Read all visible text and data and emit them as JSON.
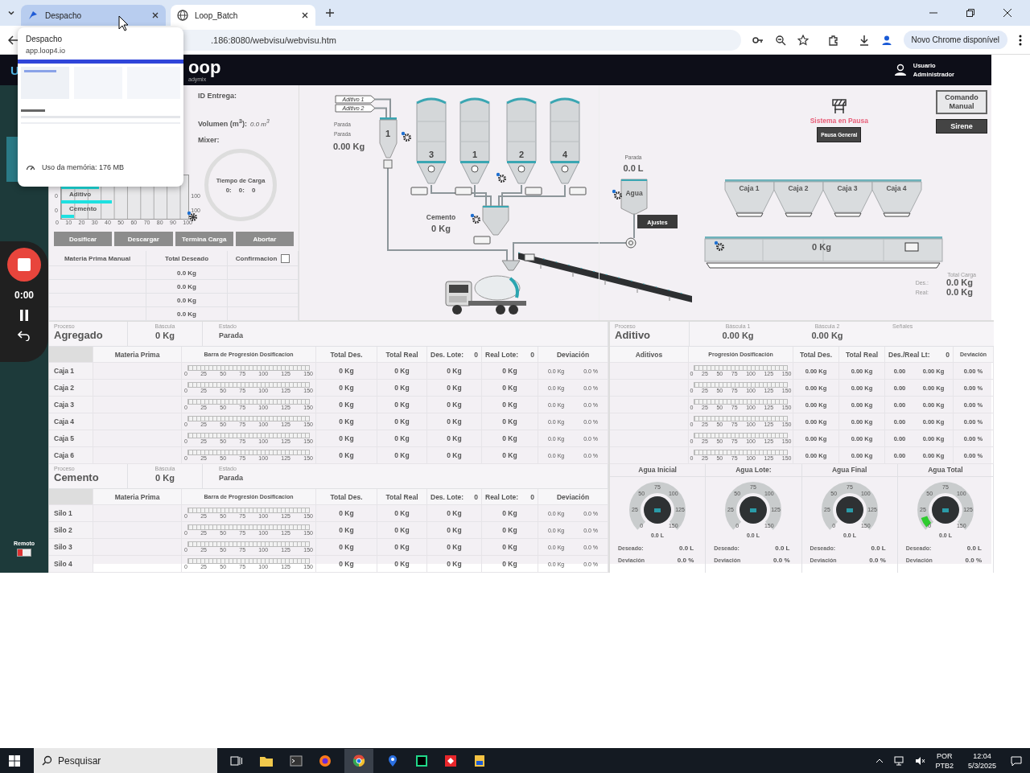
{
  "browser": {
    "tabs": [
      {
        "title": "Despacho",
        "selected": false,
        "hovered": true
      },
      {
        "title": "Loop_Batch",
        "selected": true,
        "hovered": false
      }
    ],
    "url": ".186:8080/webvisu/webvisu.htm",
    "update_button": "Novo Chrome disponível",
    "tab_preview": {
      "title": "Despacho",
      "domain": "app.loop4.io",
      "memory": "Uso da memória: 176 MB"
    }
  },
  "header": {
    "logo_left": "U",
    "logo": "oop",
    "logo_sub": "adymix",
    "user_role": "Usuario",
    "user_name": "Administrador"
  },
  "sidebar": {
    "remote_label": "Remoto",
    "remote_on": false
  },
  "recorder": {
    "time": "0:00"
  },
  "load": {
    "id_label": "ID Entrega:",
    "volume_label": "Volumen (m$^{3}$):",
    "volume": "0.0 m$^{3}$",
    "mixer_label": "Mixer:",
    "bars": [
      {
        "level": 0.3
      },
      {
        "label": "Aditivo",
        "level": 0.4,
        "min": "0",
        "max": "100"
      },
      {
        "label": "Cemento",
        "level": 0.1,
        "min": "0",
        "max": "100"
      }
    ],
    "x_ticks": [
      "0",
      "10",
      "20",
      "30",
      "40",
      "50",
      "60",
      "70",
      "80",
      "90",
      "100"
    ],
    "timer": {
      "title": "Tiempo de Carga",
      "parts": [
        "0:",
        "0:",
        "0"
      ]
    }
  },
  "buttons": [
    {
      "label": "Dosificar",
      "disabled": true
    },
    {
      "label": "Descargar",
      "disabled": true
    },
    {
      "label": "Termina Carga",
      "disabled": true
    },
    {
      "label": "Abortar",
      "disabled": true
    }
  ],
  "manual_table": {
    "columns": [
      "Materia Prima Manual",
      "Total Deseado",
      "Confirmacion"
    ],
    "confirm_checked": false,
    "rows": [
      "0.0 Kg",
      "0.0 Kg",
      "0.0 Kg",
      "0.0 Kg"
    ]
  },
  "diagram": {
    "inlets": [
      "Aditivo 1",
      "Aditivo 2"
    ],
    "additive_hopper": {
      "label": "1",
      "status_1": "Parada",
      "status_2": "Parada",
      "weight": "0.00 Kg"
    },
    "silos": [
      {
        "label": "3"
      },
      {
        "label": "1"
      },
      {
        "label": "2"
      },
      {
        "label": "4"
      }
    ],
    "cement_hopper": {
      "label": "Cemento",
      "weight": "0 Kg"
    },
    "water_tank": {
      "status": "Parada",
      "volume": "0.0 L",
      "label": "Agua"
    },
    "settings_button": "Ajustes"
  },
  "pause": {
    "status": "Sistema en Pausa",
    "button": "Pausa General"
  },
  "manual_button": "Comando Manual",
  "siren_button": "Sirene",
  "bins": [
    "Caja 1",
    "Caja 2",
    "Caja 3",
    "Caja 4"
  ],
  "belt_scale": "0 Kg",
  "total_load": {
    "title": "Total Carga",
    "desired_label": "Des.:",
    "desired": "0.0 Kg",
    "real_label": "Real:",
    "real": "0.0 Kg"
  },
  "aggregate": {
    "process_label": "Proceso",
    "process": "Agregado",
    "scale_label": "Báscula",
    "scale": "0 Kg",
    "state_label": "Estado",
    "state": "Parada",
    "columns": [
      "Materia Prima",
      "Barra de Progresión Dosificacion",
      "Total Des.",
      "Total Real",
      "Des. Lote:",
      "Real Lote:",
      "Deviación"
    ],
    "des_lote": "0",
    "real_lote": "0",
    "rows": [
      {
        "name": "Caja 1",
        "ticks": [
          "0",
          "25",
          "50",
          "75",
          "100",
          "125",
          "150"
        ],
        "total_des": "0 Kg",
        "total_real": "0 Kg",
        "des_lote": "0 Kg",
        "real_lote": "0 Kg",
        "dev_kg": "0.0 Kg",
        "dev_pct": "0.0 %"
      },
      {
        "name": "Caja 2",
        "ticks": [
          "0",
          "25",
          "50",
          "75",
          "100",
          "125",
          "150"
        ],
        "total_des": "0 Kg",
        "total_real": "0 Kg",
        "des_lote": "0 Kg",
        "real_lote": "0 Kg",
        "dev_kg": "0.0 Kg",
        "dev_pct": "0.0 %"
      },
      {
        "name": "Caja 3",
        "ticks": [
          "0",
          "25",
          "50",
          "75",
          "100",
          "125",
          "150"
        ],
        "total_des": "0 Kg",
        "total_real": "0 Kg",
        "des_lote": "0 Kg",
        "real_lote": "0 Kg",
        "dev_kg": "0.0 Kg",
        "dev_pct": "0.0 %"
      },
      {
        "name": "Caja 4",
        "ticks": [
          "0",
          "25",
          "50",
          "75",
          "100",
          "125",
          "150"
        ],
        "total_des": "0 Kg",
        "total_real": "0 Kg",
        "des_lote": "0 Kg",
        "real_lote": "0 Kg",
        "dev_kg": "0.0 Kg",
        "dev_pct": "0.0 %"
      },
      {
        "name": "Caja 5",
        "ticks": [
          "0",
          "25",
          "50",
          "75",
          "100",
          "125",
          "150"
        ],
        "total_des": "0 Kg",
        "total_real": "0 Kg",
        "des_lote": "0 Kg",
        "real_lote": "0 Kg",
        "dev_kg": "0.0 Kg",
        "dev_pct": "0.0 %"
      },
      {
        "name": "Caja 6",
        "ticks": [
          "0",
          "25",
          "50",
          "75",
          "100",
          "125",
          "150"
        ],
        "total_des": "0 Kg",
        "total_real": "0 Kg",
        "des_lote": "0 Kg",
        "real_lote": "0 Kg",
        "dev_kg": "0.0 Kg",
        "dev_pct": "0.0 %"
      }
    ]
  },
  "cement": {
    "process_label": "Proceso",
    "process": "Cemento",
    "scale_label": "Báscula",
    "scale": "0 Kg",
    "state_label": "Estado",
    "state": "Parada",
    "columns": [
      "Materia Prima",
      "Barra de Progresión Dosificacion",
      "Total Des.",
      "Total Real",
      "Des. Lote:",
      "Real Lote:",
      "Deviación"
    ],
    "des_lote": "0",
    "real_lote": "0",
    "rows": [
      {
        "name": "Silo 1",
        "ticks": [
          "0",
          "25",
          "50",
          "75",
          "100",
          "125",
          "150"
        ],
        "total_des": "0 Kg",
        "total_real": "0 Kg",
        "des_lote": "0 Kg",
        "real_lote": "0 Kg",
        "dev_kg": "0.0 Kg",
        "dev_pct": "0.0 %"
      },
      {
        "name": "Silo 2",
        "ticks": [
          "0",
          "25",
          "50",
          "75",
          "100",
          "125",
          "150"
        ],
        "total_des": "0 Kg",
        "total_real": "0 Kg",
        "des_lote": "0 Kg",
        "real_lote": "0 Kg",
        "dev_kg": "0.0 Kg",
        "dev_pct": "0.0 %"
      },
      {
        "name": "Silo 3",
        "ticks": [
          "0",
          "25",
          "50",
          "75",
          "100",
          "125",
          "150"
        ],
        "total_des": "0 Kg",
        "total_real": "0 Kg",
        "des_lote": "0 Kg",
        "real_lote": "0 Kg",
        "dev_kg": "0.0 Kg",
        "dev_pct": "0.0 %"
      },
      {
        "name": "Silo 4",
        "ticks": [
          "0",
          "25",
          "50",
          "75",
          "100",
          "125",
          "150"
        ],
        "total_des": "0 Kg",
        "total_real": "0 Kg",
        "des_lote": "0 Kg",
        "real_lote": "0 Kg",
        "dev_kg": "0.0 Kg",
        "dev_pct": "0.0 %"
      }
    ]
  },
  "additive": {
    "process_label": "Proceso",
    "process": "Aditivo",
    "scale1_label": "Báscula 1",
    "scale1": "0.00 Kg",
    "scale2_label": "Báscula 2",
    "scale2": "0.00 Kg",
    "signals_label": "Señales",
    "columns": [
      "Aditivos",
      "Progresión Dosificación",
      "Total Des.",
      "Total Real",
      "Des./Real Lt:",
      "Deviación"
    ],
    "lot": "0",
    "rows": [
      {
        "ticks": [
          "0",
          "25",
          "50",
          "75",
          "100",
          "125",
          "150"
        ],
        "total_des": "0.00 Kg",
        "total_real": "0.00 Kg",
        "des": "0.00",
        "real": "0.00 Kg",
        "dev": "0.00 %"
      },
      {
        "ticks": [
          "0",
          "25",
          "50",
          "75",
          "100",
          "125",
          "150"
        ],
        "total_des": "0.00 Kg",
        "total_real": "0.00 Kg",
        "des": "0.00",
        "real": "0.00 Kg",
        "dev": "0.00 %"
      },
      {
        "ticks": [
          "0",
          "25",
          "50",
          "75",
          "100",
          "125",
          "150"
        ],
        "total_des": "0.00 Kg",
        "total_real": "0.00 Kg",
        "des": "0.00",
        "real": "0.00 Kg",
        "dev": "0.00 %"
      },
      {
        "ticks": [
          "0",
          "25",
          "50",
          "75",
          "100",
          "125",
          "150"
        ],
        "total_des": "0.00 Kg",
        "total_real": "0.00 Kg",
        "des": "0.00",
        "real": "0.00 Kg",
        "dev": "0.00 %"
      },
      {
        "ticks": [
          "0",
          "25",
          "50",
          "75",
          "100",
          "125",
          "150"
        ],
        "total_des": "0.00 Kg",
        "total_real": "0.00 Kg",
        "des": "0.00",
        "real": "0.00 Kg",
        "dev": "0.00 %"
      },
      {
        "ticks": [
          "0",
          "25",
          "50",
          "75",
          "100",
          "125",
          "150"
        ],
        "total_des": "0.00 Kg",
        "total_real": "0.00 Kg",
        "des": "0.00",
        "real": "0.00 Kg",
        "dev": "0.00 %"
      }
    ]
  },
  "gauges": [
    {
      "title": "Agua Inicial",
      "ticks": [
        "0",
        "25",
        "50",
        "75",
        "100",
        "125",
        "150"
      ],
      "reading": "0.0 L",
      "desired_label": "Deseado:",
      "desired": "0.0 L",
      "deviation_label": "Deviación",
      "deviation": "0.0 %",
      "low_band": false
    },
    {
      "title": "Agua Lote:",
      "ticks": [
        "0",
        "25",
        "50",
        "75",
        "100",
        "125",
        "150"
      ],
      "reading": "0.0 L",
      "desired_label": "Deseado:",
      "desired": "0.0 L",
      "deviation_label": "Deviación",
      "deviation": "0.0 %",
      "low_band": false
    },
    {
      "title": "Agua Final",
      "ticks": [
        "0",
        "25",
        "50",
        "75",
        "100",
        "125",
        "150"
      ],
      "reading": "0.0 L",
      "desired_label": "Deseado:",
      "desired": "0.0 L",
      "deviation_label": "Deviación",
      "deviation": "0.0 %",
      "low_band": false
    },
    {
      "title": "Agua Total",
      "ticks": [
        "0",
        "25",
        "50",
        "75",
        "100",
        "125",
        "150"
      ],
      "reading": "0.0 L",
      "desired_label": "Deseado:",
      "desired": "0.0 L",
      "deviation_label": "Deviación",
      "deviation": "0.0 %",
      "low_band": true
    }
  ],
  "taskbar": {
    "search_placeholder": "Pesquisar",
    "language": "POR",
    "layout": "PTB2",
    "time": "12:04",
    "date": "5/3/2025"
  }
}
